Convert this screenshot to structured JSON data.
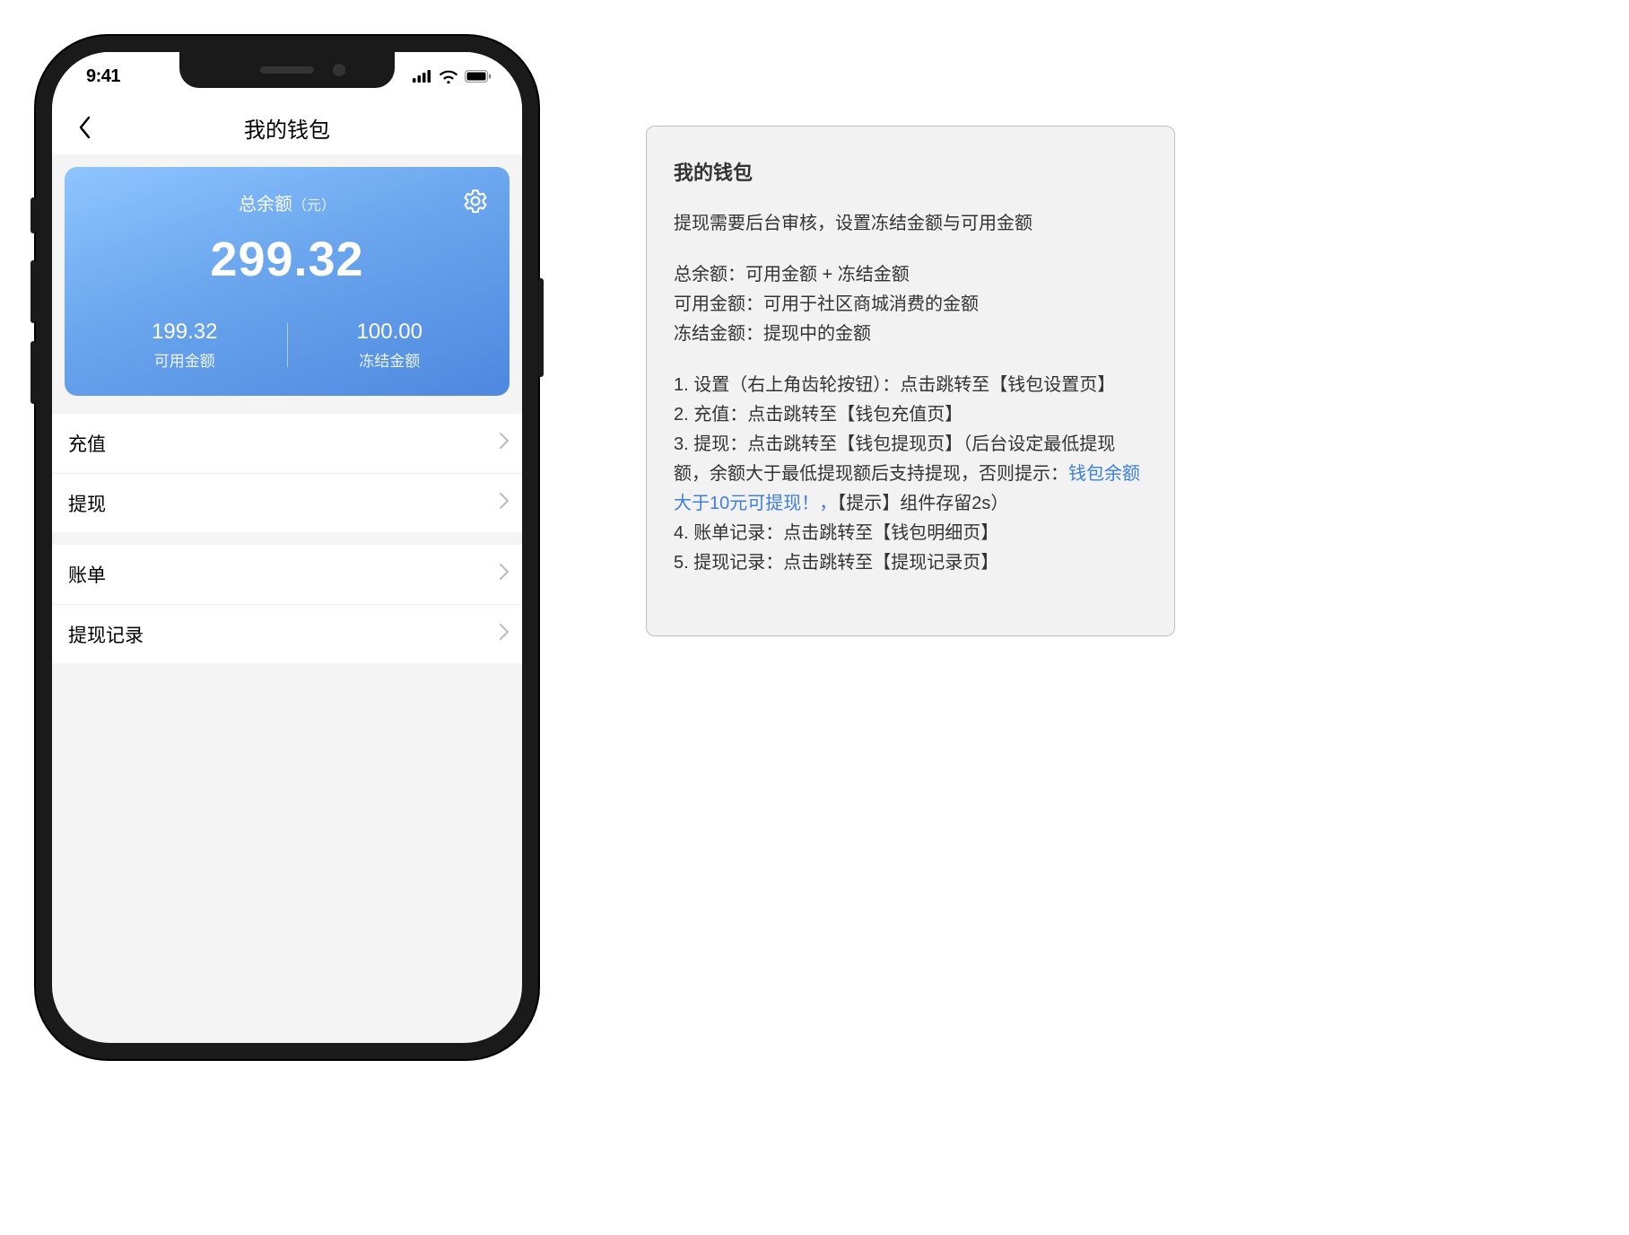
{
  "statusbar": {
    "time": "9:41"
  },
  "nav": {
    "title": "我的钱包"
  },
  "balance": {
    "label": "总余额",
    "currency": "（元）",
    "total": "299.32",
    "available_value": "199.32",
    "available_label": "可用金额",
    "frozen_value": "100.00",
    "frozen_label": "冻结金额"
  },
  "menu": {
    "group1": [
      {
        "label": "充值"
      },
      {
        "label": "提现"
      }
    ],
    "group2": [
      {
        "label": "账单"
      },
      {
        "label": "提现记录"
      }
    ]
  },
  "spec": {
    "title": "我的钱包",
    "intro": "提现需要后台审核，设置冻结金额与可用金额",
    "defs": [
      "总余额：可用金额 + 冻结金额",
      "可用金额：可用于社区商城消费的金额",
      "冻结金额：提现中的金额"
    ],
    "steps": {
      "s1": "1. 设置（右上角齿轮按钮）：点击跳转至【钱包设置页】",
      "s2": "2. 充值：点击跳转至【钱包充值页】",
      "s3a": "3. 提现：点击跳转至【钱包提现页】（后台设定最低提现额，余额大于最低提现额后支持提现，否则提示：",
      "s3b": "钱包余额大于10元可提现！，",
      "s3c": "【提示】组件存留2s）",
      "s4": "4. 账单记录：点击跳转至【钱包明细页】",
      "s5": "5. 提现记录：点击跳转至【提现记录页】"
    }
  }
}
